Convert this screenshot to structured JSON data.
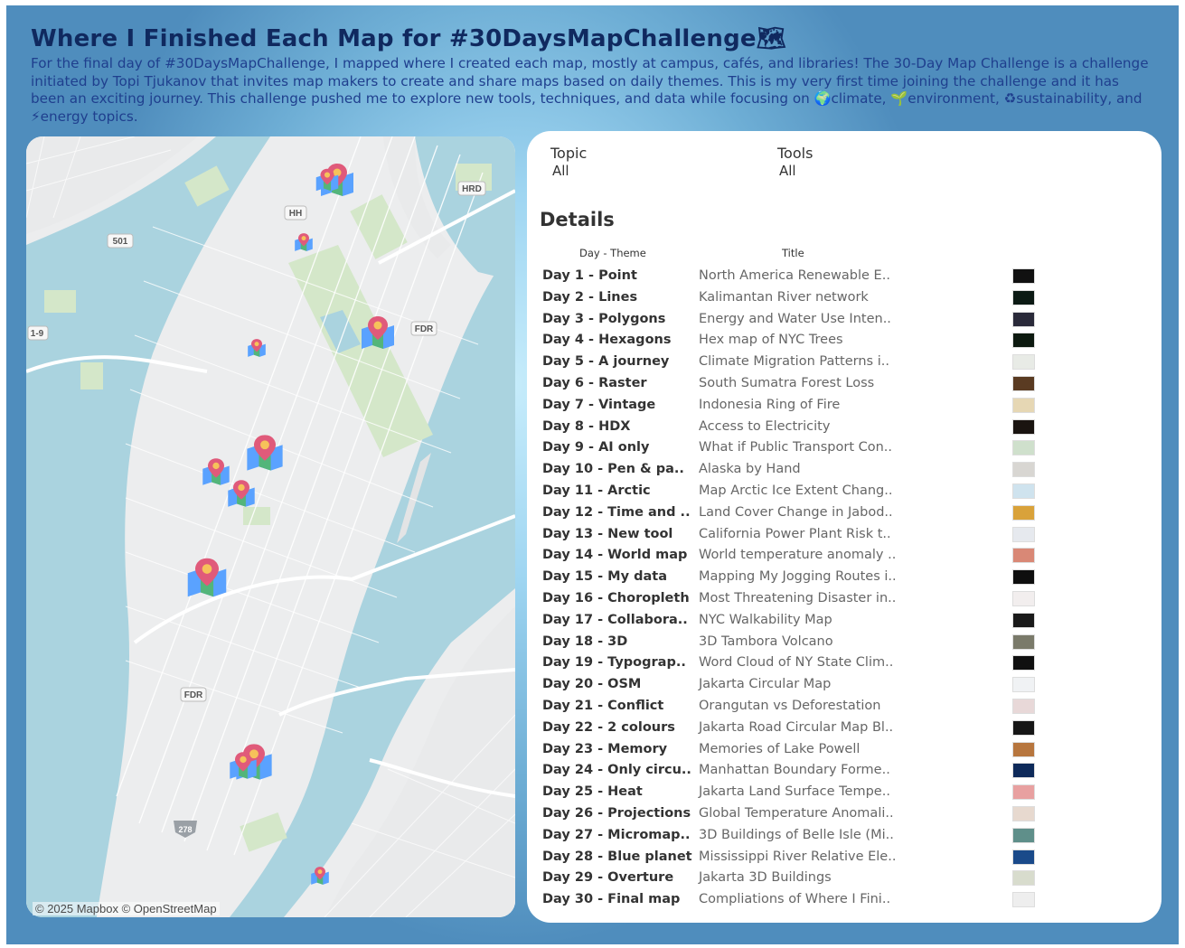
{
  "header": {
    "title": "Where I Finished Each Map for #30DaysMapChallenge🗺",
    "subtitle": "For the final day of #30DaysMapChallenge, I mapped where I created each map, mostly at campus, cafés, and libraries! The 30-Day Map Challenge is a challenge initiated by Topi Tjukanov that invites map makers to create and share maps based on daily themes. This is my very first time joining the challenge and it has been an exciting journey. This challenge pushed me to explore new tools, techniques, and data while focusing on 🌍climate, 🌱environment, ♻sustainability, and ⚡energy topics."
  },
  "map": {
    "attribution": "© 2025 Mapbox © OpenStreetMap",
    "road_labels": [
      "HRD",
      "HH",
      "501",
      "1-9",
      "FDR",
      "FDR",
      "278"
    ],
    "marker_icon": "map-pin-icon",
    "colors": {
      "land": "#ecedee",
      "water": "#aad3df",
      "park": "#d4e7c9",
      "pin": "#e05a7a",
      "road": "#ffffff"
    }
  },
  "filters": {
    "topic": {
      "label": "Topic",
      "value": "All"
    },
    "tools": {
      "label": "Tools",
      "value": "All"
    }
  },
  "details": {
    "heading": "Details",
    "columns": {
      "day": "Day - Theme",
      "title": "Title"
    },
    "rows": [
      {
        "day": "Day 1 - Point",
        "title": "North America Renewable E..",
        "thumb": "#111111"
      },
      {
        "day": "Day 2 - Lines",
        "title": "Kalimantan River network",
        "thumb": "#0c1a14"
      },
      {
        "day": "Day 3 - Polygons",
        "title": "Energy and Water Use Inten..",
        "thumb": "#2a2a3a"
      },
      {
        "day": "Day 4 - Hexagons",
        "title": "Hex map of NYC Trees",
        "thumb": "#0d1a10"
      },
      {
        "day": "Day 5 - A journey",
        "title": "Climate Migration Patterns i..",
        "thumb": "#e8ebe6"
      },
      {
        "day": "Day 6 - Raster",
        "title": "South Sumatra Forest Loss",
        "thumb": "#5a3b22"
      },
      {
        "day": "Day 7 - Vintage",
        "title": "Indonesia Ring of Fire",
        "thumb": "#e6d7b4"
      },
      {
        "day": "Day 8 - HDX",
        "title": "Access to Electricity",
        "thumb": "#1a1410"
      },
      {
        "day": "Day 9 - AI only",
        "title": "What if Public Transport Con..",
        "thumb": "#cfe0cc"
      },
      {
        "day": "Day 10 - Pen & pa..",
        "title": "Alaska by Hand",
        "thumb": "#d8d6d2"
      },
      {
        "day": "Day 11 - Arctic",
        "title": "Map Arctic Ice Extent Chang..",
        "thumb": "#cfe3ee"
      },
      {
        "day": "Day 12 - Time and ..",
        "title": "Land Cover Change in Jabod..",
        "thumb": "#d9a23a"
      },
      {
        "day": "Day 13 - New tool",
        "title": "California Power Plant Risk t..",
        "thumb": "#e6e9ee"
      },
      {
        "day": "Day 14 - World map",
        "title": "World temperature anomaly ..",
        "thumb": "#d98876"
      },
      {
        "day": "Day 15 - My data",
        "title": "Mapping My Jogging Routes i..",
        "thumb": "#0e0e0e"
      },
      {
        "day": "Day 16 - Choropleth",
        "title": "Most Threatening Disaster in..",
        "thumb": "#f2eeee"
      },
      {
        "day": "Day 17 - Collabora..",
        "title": "NYC Walkability Map",
        "thumb": "#1a1a1a"
      },
      {
        "day": "Day 18 - 3D",
        "title": "3D Tambora Volcano",
        "thumb": "#7a7a6a"
      },
      {
        "day": "Day 19 - Typograp..",
        "title": "Word Cloud of NY State Clim..",
        "thumb": "#101010"
      },
      {
        "day": "Day 20 - OSM",
        "title": "Jakarta Circular Map",
        "thumb": "#f0f2f4"
      },
      {
        "day": "Day 21 - Conflict",
        "title": "Orangutan vs Deforestation",
        "thumb": "#e8d8d8"
      },
      {
        "day": "Day 22 - 2 colours",
        "title": "Jakarta Road Circular Map Bl..",
        "thumb": "#161616"
      },
      {
        "day": "Day 23 - Memory",
        "title": "Memories of Lake Powell",
        "thumb": "#b7763e"
      },
      {
        "day": "Day 24 - Only circu..",
        "title": "Manhattan Boundary Forme..",
        "thumb": "#0e2a5a"
      },
      {
        "day": "Day 25 - Heat",
        "title": "Jakarta Land Surface Tempe..",
        "thumb": "#e8a0a0"
      },
      {
        "day": "Day 26 - Projections",
        "title": "Global Temperature Anomali..",
        "thumb": "#e7d9cf"
      },
      {
        "day": "Day 27 - Micromap..",
        "title": "3D Buildings of Belle Isle (Mi..",
        "thumb": "#5f8f8a"
      },
      {
        "day": "Day 28 - Blue planet",
        "title": "Mississippi River Relative Ele..",
        "thumb": "#1a4a8a"
      },
      {
        "day": "Day 29 - Overture",
        "title": "Jakarta 3D Buildings",
        "thumb": "#d8dccd"
      },
      {
        "day": "Day 30 - Final map",
        "title": "Compliations of Where I Fini..",
        "thumb": "#eeeeee"
      }
    ]
  }
}
